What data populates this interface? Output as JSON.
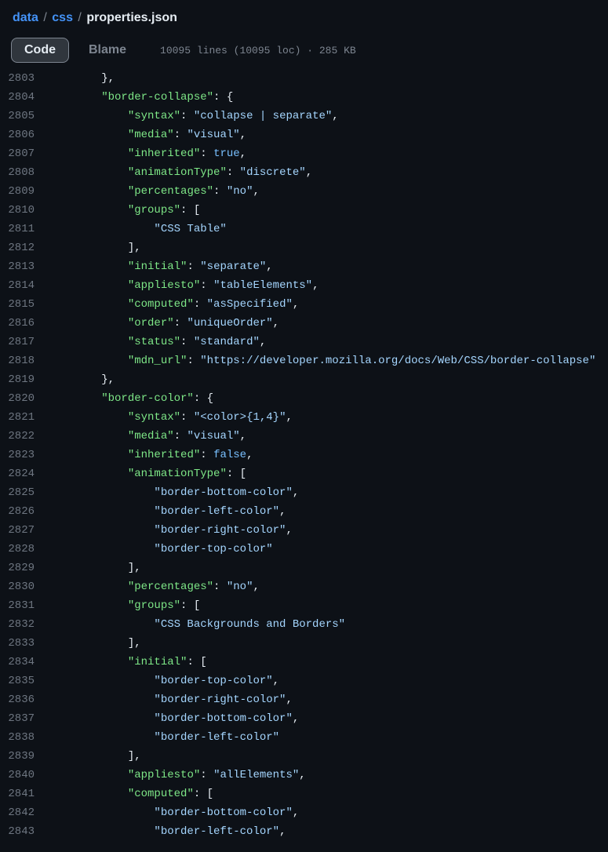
{
  "breadcrumb": {
    "segments": [
      "data",
      "css"
    ],
    "file": "properties.json",
    "sep": "/"
  },
  "tabs": {
    "code": "Code",
    "blame": "Blame"
  },
  "meta": "10095 lines (10095 loc) · 285 KB",
  "lines": [
    {
      "n": 2803,
      "indent": 2,
      "tokens": [
        {
          "t": "p",
          "v": "},"
        }
      ]
    },
    {
      "n": 2804,
      "indent": 2,
      "tokens": [
        {
          "t": "k",
          "v": "\"border-collapse\""
        },
        {
          "t": "p",
          "v": ": {"
        }
      ]
    },
    {
      "n": 2805,
      "indent": 3,
      "tokens": [
        {
          "t": "k",
          "v": "\"syntax\""
        },
        {
          "t": "p",
          "v": ": "
        },
        {
          "t": "v",
          "v": "\"collapse | separate\""
        },
        {
          "t": "p",
          "v": ","
        }
      ]
    },
    {
      "n": 2806,
      "indent": 3,
      "tokens": [
        {
          "t": "k",
          "v": "\"media\""
        },
        {
          "t": "p",
          "v": ": "
        },
        {
          "t": "v",
          "v": "\"visual\""
        },
        {
          "t": "p",
          "v": ","
        }
      ]
    },
    {
      "n": 2807,
      "indent": 3,
      "tokens": [
        {
          "t": "k",
          "v": "\"inherited\""
        },
        {
          "t": "p",
          "v": ": "
        },
        {
          "t": "b",
          "v": "true"
        },
        {
          "t": "p",
          "v": ","
        }
      ]
    },
    {
      "n": 2808,
      "indent": 3,
      "tokens": [
        {
          "t": "k",
          "v": "\"animationType\""
        },
        {
          "t": "p",
          "v": ": "
        },
        {
          "t": "v",
          "v": "\"discrete\""
        },
        {
          "t": "p",
          "v": ","
        }
      ]
    },
    {
      "n": 2809,
      "indent": 3,
      "tokens": [
        {
          "t": "k",
          "v": "\"percentages\""
        },
        {
          "t": "p",
          "v": ": "
        },
        {
          "t": "v",
          "v": "\"no\""
        },
        {
          "t": "p",
          "v": ","
        }
      ]
    },
    {
      "n": 2810,
      "indent": 3,
      "tokens": [
        {
          "t": "k",
          "v": "\"groups\""
        },
        {
          "t": "p",
          "v": ": ["
        }
      ]
    },
    {
      "n": 2811,
      "indent": 4,
      "tokens": [
        {
          "t": "v",
          "v": "\"CSS Table\""
        }
      ]
    },
    {
      "n": 2812,
      "indent": 3,
      "tokens": [
        {
          "t": "p",
          "v": "],"
        }
      ]
    },
    {
      "n": 2813,
      "indent": 3,
      "tokens": [
        {
          "t": "k",
          "v": "\"initial\""
        },
        {
          "t": "p",
          "v": ": "
        },
        {
          "t": "v",
          "v": "\"separate\""
        },
        {
          "t": "p",
          "v": ","
        }
      ]
    },
    {
      "n": 2814,
      "indent": 3,
      "tokens": [
        {
          "t": "k",
          "v": "\"appliesto\""
        },
        {
          "t": "p",
          "v": ": "
        },
        {
          "t": "v",
          "v": "\"tableElements\""
        },
        {
          "t": "p",
          "v": ","
        }
      ]
    },
    {
      "n": 2815,
      "indent": 3,
      "tokens": [
        {
          "t": "k",
          "v": "\"computed\""
        },
        {
          "t": "p",
          "v": ": "
        },
        {
          "t": "v",
          "v": "\"asSpecified\""
        },
        {
          "t": "p",
          "v": ","
        }
      ]
    },
    {
      "n": 2816,
      "indent": 3,
      "tokens": [
        {
          "t": "k",
          "v": "\"order\""
        },
        {
          "t": "p",
          "v": ": "
        },
        {
          "t": "v",
          "v": "\"uniqueOrder\""
        },
        {
          "t": "p",
          "v": ","
        }
      ]
    },
    {
      "n": 2817,
      "indent": 3,
      "tokens": [
        {
          "t": "k",
          "v": "\"status\""
        },
        {
          "t": "p",
          "v": ": "
        },
        {
          "t": "v",
          "v": "\"standard\""
        },
        {
          "t": "p",
          "v": ","
        }
      ]
    },
    {
      "n": 2818,
      "indent": 3,
      "tokens": [
        {
          "t": "k",
          "v": "\"mdn_url\""
        },
        {
          "t": "p",
          "v": ": "
        },
        {
          "t": "v",
          "v": "\"https://developer.mozilla.org/docs/Web/CSS/border-collapse\""
        }
      ]
    },
    {
      "n": 2819,
      "indent": 2,
      "tokens": [
        {
          "t": "p",
          "v": "},"
        }
      ]
    },
    {
      "n": 2820,
      "indent": 2,
      "tokens": [
        {
          "t": "k",
          "v": "\"border-color\""
        },
        {
          "t": "p",
          "v": ": {"
        }
      ]
    },
    {
      "n": 2821,
      "indent": 3,
      "tokens": [
        {
          "t": "k",
          "v": "\"syntax\""
        },
        {
          "t": "p",
          "v": ": "
        },
        {
          "t": "v",
          "v": "\"<color>{1,4}\""
        },
        {
          "t": "p",
          "v": ","
        }
      ]
    },
    {
      "n": 2822,
      "indent": 3,
      "tokens": [
        {
          "t": "k",
          "v": "\"media\""
        },
        {
          "t": "p",
          "v": ": "
        },
        {
          "t": "v",
          "v": "\"visual\""
        },
        {
          "t": "p",
          "v": ","
        }
      ]
    },
    {
      "n": 2823,
      "indent": 3,
      "tokens": [
        {
          "t": "k",
          "v": "\"inherited\""
        },
        {
          "t": "p",
          "v": ": "
        },
        {
          "t": "b",
          "v": "false"
        },
        {
          "t": "p",
          "v": ","
        }
      ]
    },
    {
      "n": 2824,
      "indent": 3,
      "tokens": [
        {
          "t": "k",
          "v": "\"animationType\""
        },
        {
          "t": "p",
          "v": ": ["
        }
      ]
    },
    {
      "n": 2825,
      "indent": 4,
      "tokens": [
        {
          "t": "v",
          "v": "\"border-bottom-color\""
        },
        {
          "t": "p",
          "v": ","
        }
      ]
    },
    {
      "n": 2826,
      "indent": 4,
      "tokens": [
        {
          "t": "v",
          "v": "\"border-left-color\""
        },
        {
          "t": "p",
          "v": ","
        }
      ]
    },
    {
      "n": 2827,
      "indent": 4,
      "tokens": [
        {
          "t": "v",
          "v": "\"border-right-color\""
        },
        {
          "t": "p",
          "v": ","
        }
      ]
    },
    {
      "n": 2828,
      "indent": 4,
      "tokens": [
        {
          "t": "v",
          "v": "\"border-top-color\""
        }
      ]
    },
    {
      "n": 2829,
      "indent": 3,
      "tokens": [
        {
          "t": "p",
          "v": "],"
        }
      ]
    },
    {
      "n": 2830,
      "indent": 3,
      "tokens": [
        {
          "t": "k",
          "v": "\"percentages\""
        },
        {
          "t": "p",
          "v": ": "
        },
        {
          "t": "v",
          "v": "\"no\""
        },
        {
          "t": "p",
          "v": ","
        }
      ]
    },
    {
      "n": 2831,
      "indent": 3,
      "tokens": [
        {
          "t": "k",
          "v": "\"groups\""
        },
        {
          "t": "p",
          "v": ": ["
        }
      ]
    },
    {
      "n": 2832,
      "indent": 4,
      "tokens": [
        {
          "t": "v",
          "v": "\"CSS Backgrounds and Borders\""
        }
      ]
    },
    {
      "n": 2833,
      "indent": 3,
      "tokens": [
        {
          "t": "p",
          "v": "],"
        }
      ]
    },
    {
      "n": 2834,
      "indent": 3,
      "tokens": [
        {
          "t": "k",
          "v": "\"initial\""
        },
        {
          "t": "p",
          "v": ": ["
        }
      ]
    },
    {
      "n": 2835,
      "indent": 4,
      "tokens": [
        {
          "t": "v",
          "v": "\"border-top-color\""
        },
        {
          "t": "p",
          "v": ","
        }
      ]
    },
    {
      "n": 2836,
      "indent": 4,
      "tokens": [
        {
          "t": "v",
          "v": "\"border-right-color\""
        },
        {
          "t": "p",
          "v": ","
        }
      ]
    },
    {
      "n": 2837,
      "indent": 4,
      "tokens": [
        {
          "t": "v",
          "v": "\"border-bottom-color\""
        },
        {
          "t": "p",
          "v": ","
        }
      ]
    },
    {
      "n": 2838,
      "indent": 4,
      "tokens": [
        {
          "t": "v",
          "v": "\"border-left-color\""
        }
      ]
    },
    {
      "n": 2839,
      "indent": 3,
      "tokens": [
        {
          "t": "p",
          "v": "],"
        }
      ]
    },
    {
      "n": 2840,
      "indent": 3,
      "tokens": [
        {
          "t": "k",
          "v": "\"appliesto\""
        },
        {
          "t": "p",
          "v": ": "
        },
        {
          "t": "v",
          "v": "\"allElements\""
        },
        {
          "t": "p",
          "v": ","
        }
      ]
    },
    {
      "n": 2841,
      "indent": 3,
      "tokens": [
        {
          "t": "k",
          "v": "\"computed\""
        },
        {
          "t": "p",
          "v": ": ["
        }
      ]
    },
    {
      "n": 2842,
      "indent": 4,
      "tokens": [
        {
          "t": "v",
          "v": "\"border-bottom-color\""
        },
        {
          "t": "p",
          "v": ","
        }
      ]
    },
    {
      "n": 2843,
      "indent": 4,
      "tokens": [
        {
          "t": "v",
          "v": "\"border-left-color\""
        },
        {
          "t": "p",
          "v": ","
        }
      ]
    }
  ],
  "colors": {
    "key": "#7ee787",
    "string": "#a5d6ff",
    "bool": "#79c0ff",
    "punc": "#e6edf3",
    "link": "#4493f8"
  }
}
